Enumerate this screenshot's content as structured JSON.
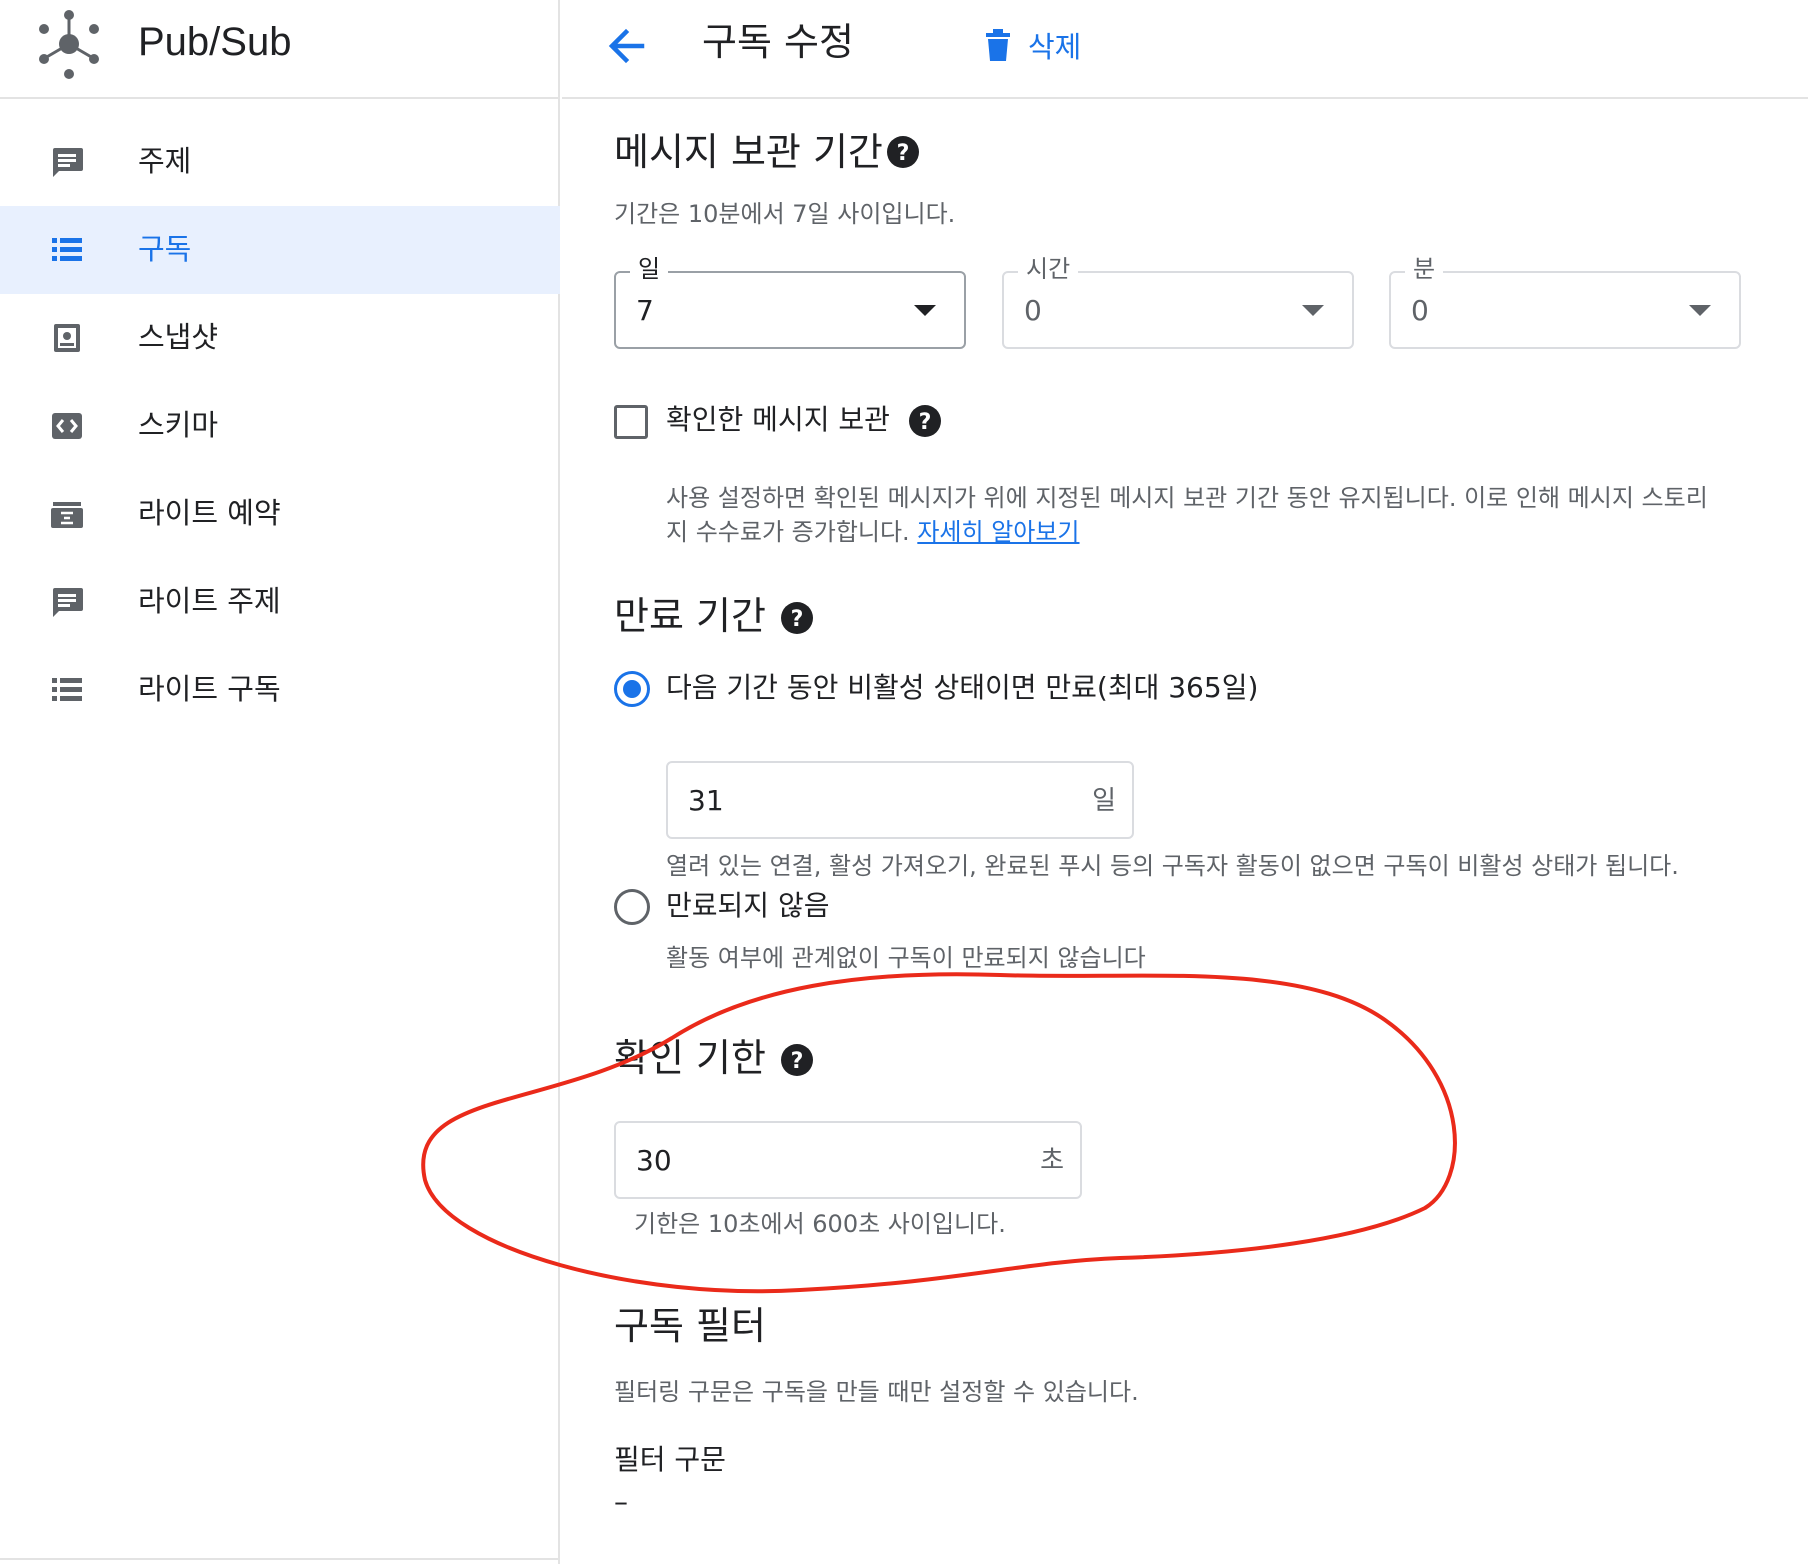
{
  "app": {
    "title": "Pub/Sub"
  },
  "sidebar": {
    "items": [
      {
        "label": "주제",
        "icon": "message-icon",
        "active": false
      },
      {
        "label": "구독",
        "icon": "list-icon",
        "active": true
      },
      {
        "label": "스냅샷",
        "icon": "snapshot-icon",
        "active": false
      },
      {
        "label": "스키마",
        "icon": "schema-icon",
        "active": false
      },
      {
        "label": "라이트 예약",
        "icon": "reservation-icon",
        "active": false
      },
      {
        "label": "라이트 주제",
        "icon": "message-icon",
        "active": false
      },
      {
        "label": "라이트 구독",
        "icon": "list-icon",
        "active": false
      }
    ]
  },
  "header": {
    "title": "구독 수정",
    "delete_label": "삭제"
  },
  "retention": {
    "heading": "메시지 보관 기간",
    "hint": "기간은 10분에서 7일 사이입니다.",
    "days": {
      "label": "일",
      "value": "7"
    },
    "hours": {
      "label": "시간",
      "value": "0"
    },
    "minutes": {
      "label": "분",
      "value": "0"
    },
    "retain_acked": {
      "label": "확인한 메시지 보관",
      "checked": false,
      "desc_line1": "사용 설정하면 확인된 메시지가 위에 지정된 메시지 보관 기간 동안 유지됩니다. 이로 인해 메시지 스토리",
      "desc_line2": "지 수수료가 증가합니다. ",
      "link": "자세히 알아보기"
    }
  },
  "expiration": {
    "heading": "만료 기간",
    "option_expire": "다음 기간 동안 비활성 상태이면 만료(최대 365일)",
    "days_value": "31",
    "days_suffix": "일",
    "expire_hint": "열려 있는 연결, 활성 가져오기, 완료된 푸시 등의 구독자 활동이 없으면 구독이 비활성 상태가 됩니다.",
    "option_never": "만료되지 않음",
    "never_hint": "활동 여부에 관계없이 구독이 만료되지 않습니다",
    "selected": "expire"
  },
  "ack_deadline": {
    "heading": "확인 기한",
    "value": "30",
    "suffix": "초",
    "hint": "기한은 10초에서 600초 사이입니다."
  },
  "filter": {
    "heading": "구독 필터",
    "hint": "필터링 구문은 구독을 만들 때만 설정할 수 있습니다.",
    "syntax_label": "필터 구문",
    "syntax_value": "–"
  },
  "colors": {
    "accent": "#1a73e8",
    "annotation": "#ea2a1a",
    "active_bg": "#e8f0fe"
  }
}
